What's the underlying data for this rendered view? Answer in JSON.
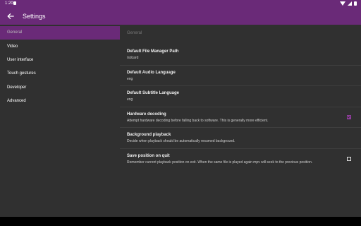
{
  "status_bar": {
    "time": "1:20",
    "icons": [
      "sd-card-icon",
      "wifi-icon",
      "signal-icon",
      "battery-icon"
    ]
  },
  "app_bar": {
    "title": "Settings",
    "back_icon": "arrow-back-icon"
  },
  "sidebar": {
    "items": [
      {
        "label": "General",
        "selected": true
      },
      {
        "label": "Video",
        "selected": false
      },
      {
        "label": "User interface",
        "selected": false
      },
      {
        "label": "Touch gestures",
        "selected": false
      },
      {
        "label": "Developer",
        "selected": false
      },
      {
        "label": "Advanced",
        "selected": false
      }
    ]
  },
  "pane": {
    "section_header": "General",
    "prefs": [
      {
        "title": "Default File Manager Path",
        "summary": "/sdcard"
      },
      {
        "title": "Default Audio Language",
        "summary": "eng"
      },
      {
        "title": "Default Subtitle Language",
        "summary": "eng"
      },
      {
        "title": "Hardware decoding",
        "summary": "Attempt hardware decoding before falling back to software. This is generally more efficient.",
        "checked": true
      },
      {
        "title": "Background playback",
        "summary": "Decide when playback should be automatically resumed background."
      },
      {
        "title": "Save position on quit",
        "summary": "Remember current playback position on exit. When the same file is played again mpv will seek to the previous position.",
        "checked": false
      }
    ]
  },
  "colors": {
    "primary": "#6a2a78",
    "background": "#303030",
    "accent": "#8e3c9b"
  }
}
